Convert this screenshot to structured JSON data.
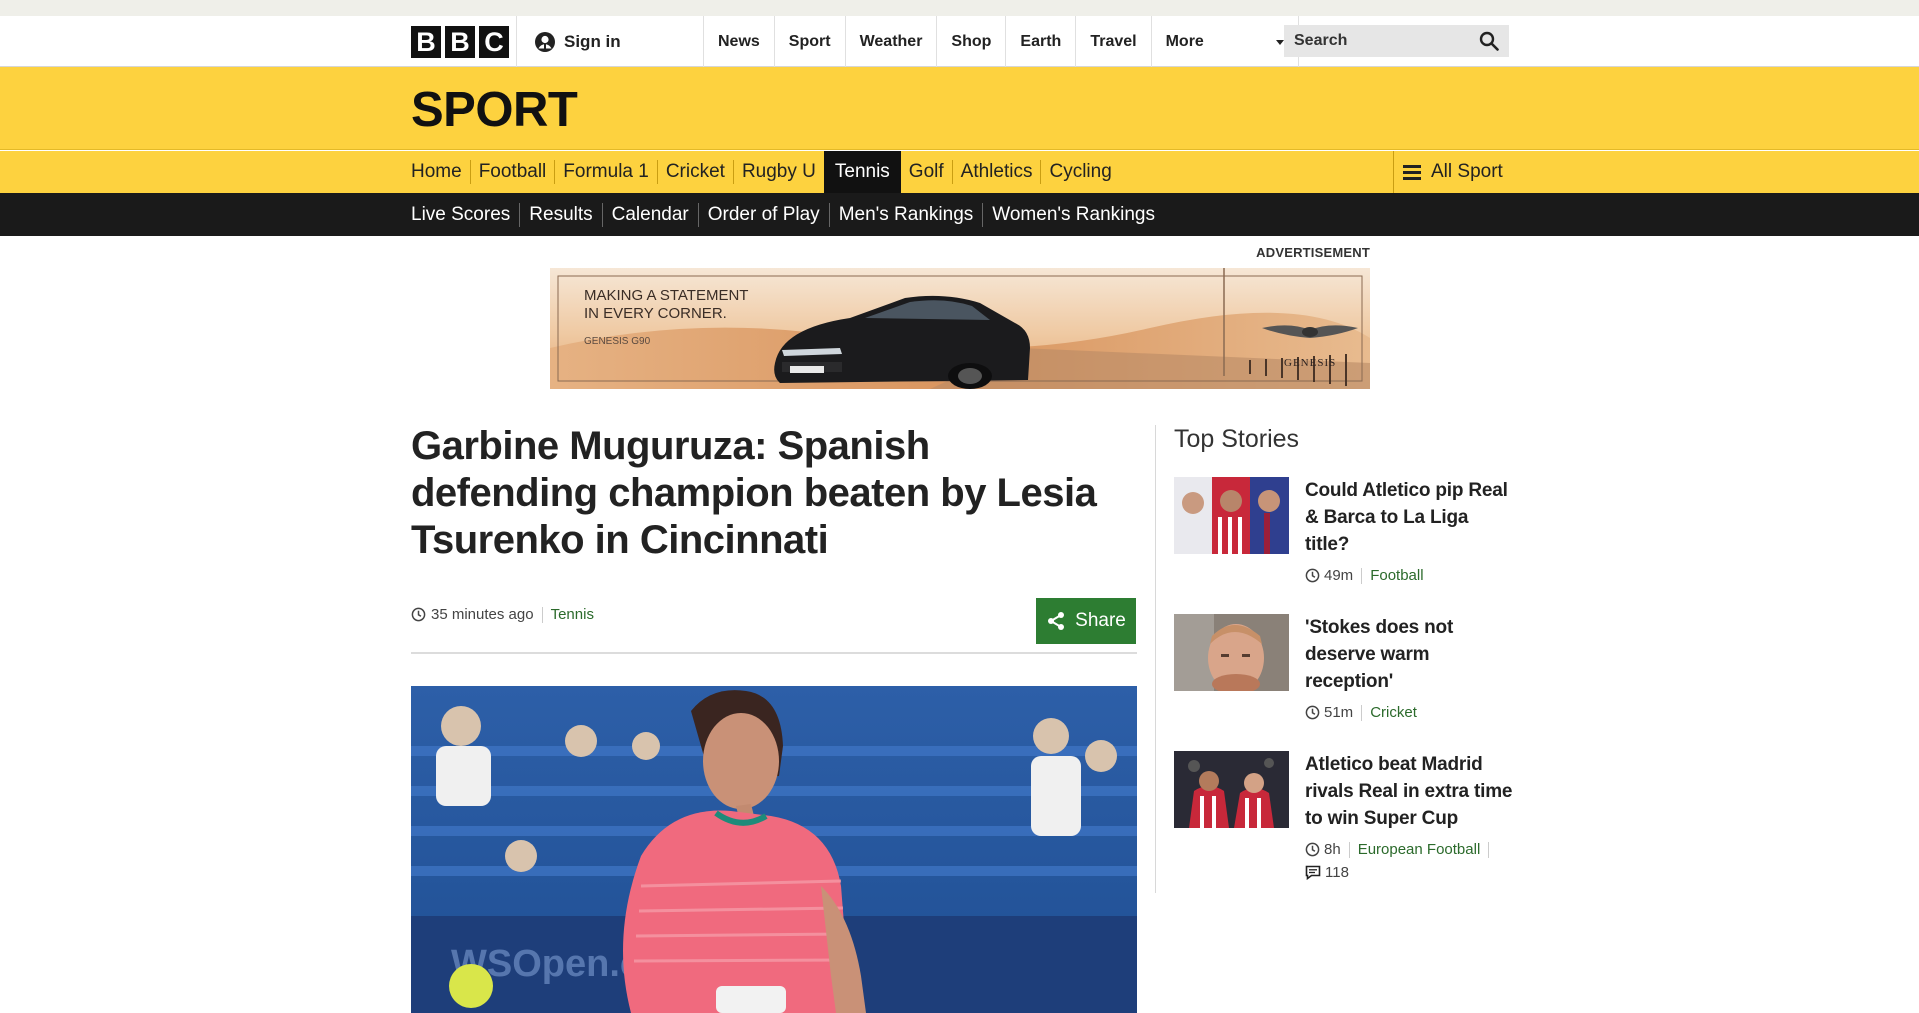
{
  "masthead": {
    "logo_letters": [
      "B",
      "B",
      "C"
    ],
    "signin_label": "Sign in",
    "nav": [
      "News",
      "Sport",
      "Weather",
      "Shop",
      "Earth",
      "Travel"
    ],
    "more_label": "More",
    "search_placeholder": "Search"
  },
  "sport": {
    "title": "SPORT",
    "nav": [
      "Home",
      "Football",
      "Formula 1",
      "Cricket",
      "Rugby U",
      "Tennis",
      "Golf",
      "Athletics",
      "Cycling"
    ],
    "active_nav": "Tennis",
    "all_sport_label": "All Sport",
    "subnav": [
      "Live Scores",
      "Results",
      "Calendar",
      "Order of Play",
      "Men's Rankings",
      "Women's Rankings"
    ]
  },
  "advert": {
    "label": "ADVERTISEMENT",
    "line1": "MAKING A STATEMENT",
    "line2": "IN EVERY CORNER.",
    "model": "GENESIS G90",
    "brand": "GENESIS"
  },
  "article": {
    "headline": "Garbine Muguruza: Spanish defending champion beaten by Lesia Tsurenko in Cincinnati",
    "time": "35 minutes ago",
    "topic": "Tennis",
    "share_label": "Share",
    "hero_banner_text": "WSOpen.com"
  },
  "sidebar": {
    "title": "Top Stories",
    "stories": [
      {
        "title": "Could Atletico pip Real & Barca to La Liga title?",
        "time": "49m",
        "topic": "Football"
      },
      {
        "title": "'Stokes does not deserve warm reception'",
        "time": "51m",
        "topic": "Cricket"
      },
      {
        "title": "Atletico beat Madrid rivals Real in extra time to win Super Cup",
        "time": "8h",
        "topic": "European Football",
        "comments": "118"
      }
    ]
  },
  "colors": {
    "sport_yellow": "#fdd23f",
    "nav_black": "#1a1a1a",
    "share_green": "#2d7d32",
    "topic_green": "#2b6a2b"
  }
}
